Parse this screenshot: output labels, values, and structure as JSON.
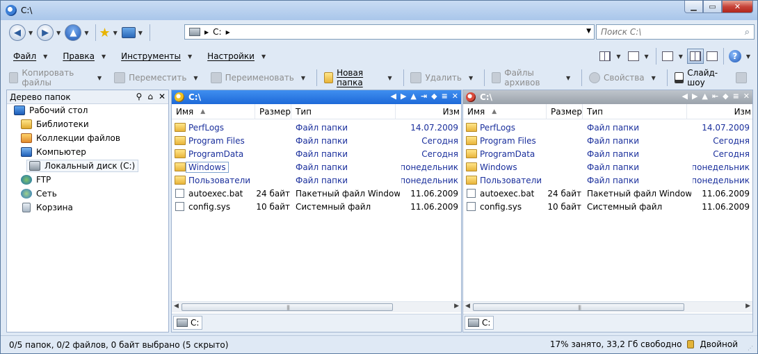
{
  "window": {
    "title": "C:\\"
  },
  "window_buttons": {
    "min": "▁",
    "max": "▭",
    "close": "✕"
  },
  "nav": {
    "address": "C:",
    "search_placeholder": "Поиск C:\\"
  },
  "menu": [
    {
      "label": "Файл"
    },
    {
      "label": "Правка"
    },
    {
      "label": "Инструменты"
    },
    {
      "label": "Настройки"
    }
  ],
  "commands": {
    "copy": "Копировать файлы",
    "move": "Переместить",
    "rename": "Переименовать",
    "new_folder": "Новая папка",
    "delete": "Удалить",
    "archives": "Файлы архивов",
    "properties": "Свойства",
    "slideshow": "Слайд-шоу"
  },
  "tree": {
    "header": "Дерево папок",
    "items": [
      {
        "label": "Рабочий стол",
        "icon": "desktop-icon"
      },
      {
        "label": "Библиотеки",
        "icon": "libraries-icon"
      },
      {
        "label": "Коллекции файлов",
        "icon": "collections-icon"
      },
      {
        "label": "Компьютер",
        "icon": "computer-icon"
      },
      {
        "label": "Локальный диск (C:)",
        "icon": "drive-icon"
      },
      {
        "label": "FTP",
        "icon": "ftp-icon"
      },
      {
        "label": "Сеть",
        "icon": "network-icon"
      },
      {
        "label": "Корзина",
        "icon": "recycle-bin-icon"
      }
    ]
  },
  "panes": [
    {
      "title": "C:\\",
      "active": true,
      "columns": {
        "name": "Имя",
        "size": "Размер",
        "type": "Тип",
        "date": "Изм"
      },
      "tab": "C:",
      "rows": [
        {
          "name": "PerfLogs",
          "size": "",
          "type": "Файл папки",
          "date": "14.07.2009",
          "kind": "folder"
        },
        {
          "name": "Program Files",
          "size": "",
          "type": "Файл папки",
          "date": "Сегодня",
          "kind": "folder"
        },
        {
          "name": "ProgramData",
          "size": "",
          "type": "Файл папки",
          "date": "Сегодня",
          "kind": "folder"
        },
        {
          "name": "Windows",
          "size": "",
          "type": "Файл папки",
          "date": "понедельник",
          "kind": "folder"
        },
        {
          "name": "Пользователи",
          "size": "",
          "type": "Файл папки",
          "date": "понедельник",
          "kind": "folder"
        },
        {
          "name": "autoexec.bat",
          "size": "24 байт",
          "type": "Пакетный файл Windows",
          "date": "11.06.2009",
          "kind": "file"
        },
        {
          "name": "config.sys",
          "size": "10 байт",
          "type": "Системный файл",
          "date": "11.06.2009",
          "kind": "file"
        }
      ]
    },
    {
      "title": "C:\\",
      "active": false,
      "columns": {
        "name": "Имя",
        "size": "Размер",
        "type": "Тип",
        "date": "Изм"
      },
      "tab": "C:",
      "rows": [
        {
          "name": "PerfLogs",
          "size": "",
          "type": "Файл папки",
          "date": "14.07.2009",
          "kind": "folder"
        },
        {
          "name": "Program Files",
          "size": "",
          "type": "Файл папки",
          "date": "Сегодня",
          "kind": "folder"
        },
        {
          "name": "ProgramData",
          "size": "",
          "type": "Файл папки",
          "date": "Сегодня",
          "kind": "folder"
        },
        {
          "name": "Windows",
          "size": "",
          "type": "Файл папки",
          "date": "понедельник",
          "kind": "folder"
        },
        {
          "name": "Пользователи",
          "size": "",
          "type": "Файл папки",
          "date": "понедельник",
          "kind": "folder"
        },
        {
          "name": "autoexec.bat",
          "size": "24 байт",
          "type": "Пакетный файл Windows",
          "date": "11.06.2009",
          "kind": "file"
        },
        {
          "name": "config.sys",
          "size": "10 байт",
          "type": "Системный файл",
          "date": "11.06.2009",
          "kind": "file"
        }
      ]
    }
  ],
  "status": {
    "selection": "0/5 папок, 0/2 файлов, 0 байт выбрано (5 скрыто)",
    "disk": "17% занято, 33,2 Гб свободно",
    "mode": "Двойной"
  }
}
